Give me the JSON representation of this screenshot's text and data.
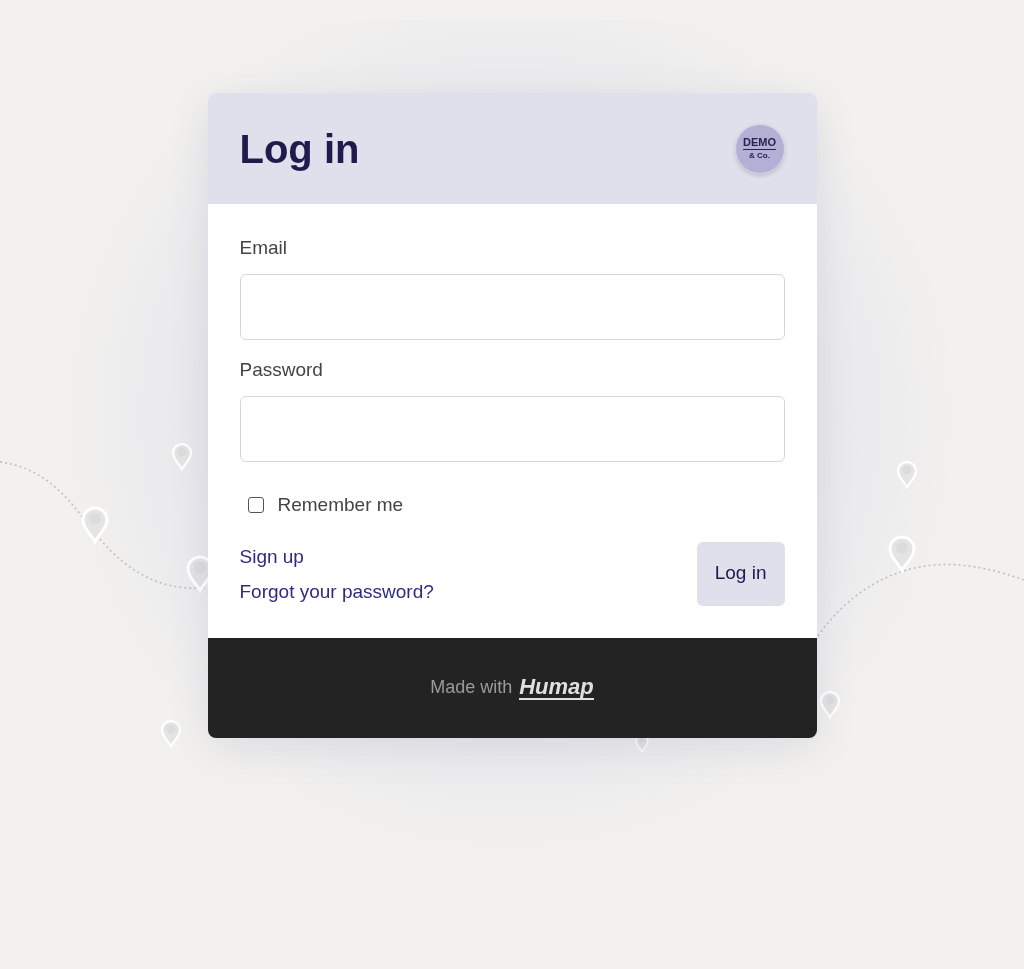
{
  "header": {
    "title": "Log in",
    "logo": {
      "line_1": "DEMO",
      "line_2": "& Co."
    }
  },
  "form": {
    "email": {
      "label": "Email"
    },
    "password": {
      "label": "Password"
    },
    "remember": {
      "label": "Remember me",
      "checked": false
    },
    "links": [
      "Sign up",
      "Forgot your password?"
    ],
    "submit": "Log in"
  },
  "footer": {
    "text": "Made with",
    "brand": "Humap"
  }
}
